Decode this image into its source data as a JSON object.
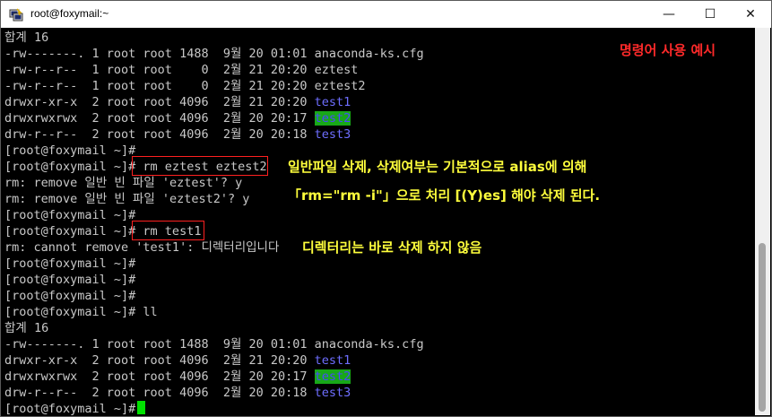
{
  "window": {
    "title": "root@foxymail:~",
    "controls": {
      "minimize": "—",
      "maximize": "☐",
      "close": "✕"
    }
  },
  "colors": {
    "annotation_red": "#ff2a2a",
    "annotation_yellow": "#ffff3c",
    "dir_blue": "#6e6eff",
    "highlight_green": "#18a818"
  },
  "terminal": {
    "lines": [
      {
        "parts": [
          {
            "t": "합계 16"
          }
        ]
      },
      {
        "parts": [
          {
            "t": "-rw-------. 1 root root 1488  9월 20 01:01 anaconda-ks.cfg"
          }
        ]
      },
      {
        "parts": [
          {
            "t": "-rw-r--r--  1 root root    0  2월 21 20:20 eztest"
          }
        ]
      },
      {
        "parts": [
          {
            "t": "-rw-r--r--  1 root root    0  2월 21 20:20 eztest2"
          }
        ]
      },
      {
        "parts": [
          {
            "t": "drwxr-xr-x  2 root root 4096  2월 21 20:20 "
          },
          {
            "t": "test1",
            "c": "blue"
          }
        ]
      },
      {
        "parts": [
          {
            "t": "drwxrwxrwx  2 root root 4096  2월 20 20:17 "
          },
          {
            "t": "test2",
            "c": "hl"
          }
        ]
      },
      {
        "parts": [
          {
            "t": "drw-r--r--  2 root root 4096  2월 20 20:18 "
          },
          {
            "t": "test3",
            "c": "blue"
          }
        ]
      },
      {
        "parts": [
          {
            "t": "[root@foxymail ~]#"
          }
        ]
      },
      {
        "parts": [
          {
            "t": "[root@foxymail ~]# rm eztest eztest2"
          }
        ]
      },
      {
        "parts": [
          {
            "t": "rm: remove 일반 빈 파일 'eztest'? y"
          }
        ]
      },
      {
        "parts": [
          {
            "t": "rm: remove 일반 빈 파일 'eztest2'? y"
          }
        ]
      },
      {
        "parts": [
          {
            "t": "[root@foxymail ~]#"
          }
        ]
      },
      {
        "parts": [
          {
            "t": "[root@foxymail ~]# rm test1"
          }
        ]
      },
      {
        "parts": [
          {
            "t": "rm: cannot remove 'test1': 디렉터리입니다"
          }
        ]
      },
      {
        "parts": [
          {
            "t": "[root@foxymail ~]#"
          }
        ]
      },
      {
        "parts": [
          {
            "t": "[root@foxymail ~]#"
          }
        ]
      },
      {
        "parts": [
          {
            "t": "[root@foxymail ~]#"
          }
        ]
      },
      {
        "parts": [
          {
            "t": "[root@foxymail ~]# ll"
          }
        ]
      },
      {
        "parts": [
          {
            "t": "합계 16"
          }
        ]
      },
      {
        "parts": [
          {
            "t": "-rw-------. 1 root root 1488  9월 20 01:01 anaconda-ks.cfg"
          }
        ]
      },
      {
        "parts": [
          {
            "t": "drwxr-xr-x  2 root root 4096  2월 21 20:20 "
          },
          {
            "t": "test1",
            "c": "blue"
          }
        ]
      },
      {
        "parts": [
          {
            "t": "drwxrwxrwx  2 root root 4096  2월 20 20:17 "
          },
          {
            "t": "test2",
            "c": "hl"
          }
        ]
      },
      {
        "parts": [
          {
            "t": "drw-r--r--  2 root root 4096  2월 20 20:18 "
          },
          {
            "t": "test3",
            "c": "blue"
          }
        ]
      },
      {
        "parts": [
          {
            "t": "[root@foxymail ~]# "
          }
        ]
      }
    ]
  },
  "annotations": {
    "title": "명령어 사용 예시",
    "note1_line1": "일반파일 삭제, 삭제여부는 기본적으로 alias에 의해",
    "note1_line2": "「rm=\"rm -i\"」으로 처리  [(Y)es] 해야 삭제 된다.",
    "note2": "디렉터리는 바로 삭제 하지 않음"
  }
}
